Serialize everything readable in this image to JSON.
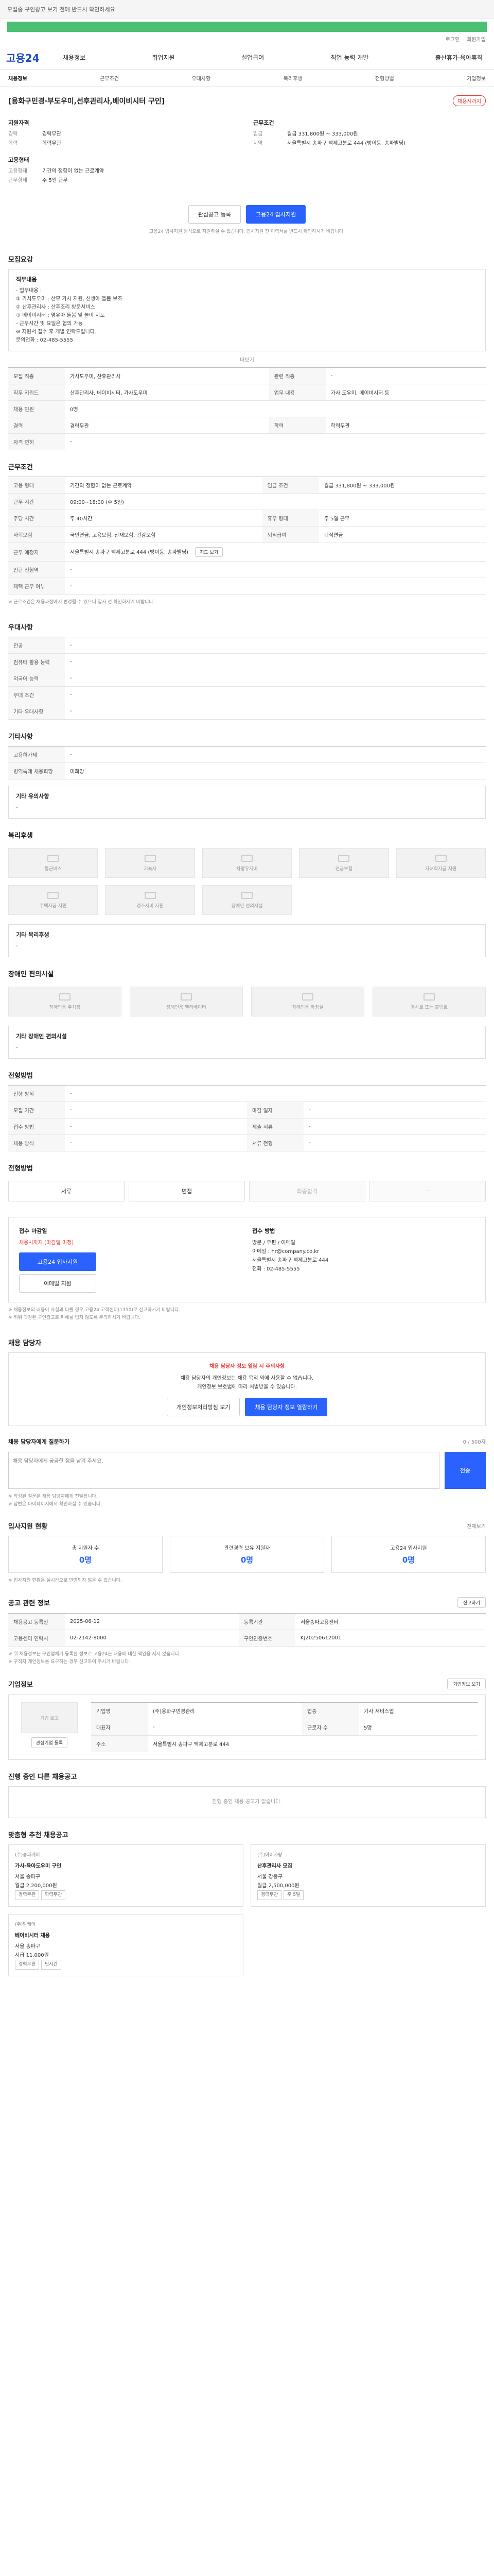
{
  "topbar": {
    "text": "모집중 구인광고 보기 전에 반드시 확인하세요"
  },
  "util": {
    "login": "로그인",
    "join": "회원가입"
  },
  "gnb": {
    "logo": "고용24",
    "menu": [
      "채용정보",
      "취업지원",
      "실업급여",
      "직업 능력 개발",
      "출산휴가·육아휴직"
    ]
  },
  "tabs": [
    "채용정보",
    "근무조건",
    "우대사항",
    "복리후생",
    "전형방법",
    "기업정보"
  ],
  "job": {
    "title": "[용화구민경·부도우미,선후관리사,베이비시터 구인]",
    "status": "채용시까지",
    "left_title": "지원자격",
    "right_title": "근무조건",
    "career_k": "경력",
    "career_v": "경력무관",
    "edu_k": "학력",
    "edu_v": "학력무관",
    "pay_k": "임금",
    "pay_v": "월급 331,800원 ~ 333,000원",
    "place_k": "지역",
    "place_v": "서울특별시 송파구 백제고분로 444 (방이동, 송파빌딩)",
    "type_title": "고용형태",
    "type_k": "고용형태",
    "type_v": "기간의 정함이 없는 근로계약",
    "hours_k": "근무형태",
    "hours_v": "주 5일 근무"
  },
  "actions": {
    "scrap": "관심공고 등록",
    "apply": "고용24 입사지원",
    "notice": "고용24 입사지원 방식으로 지원하실 수 있습니다. 입사지원 전 이력서를 반드시 확인하시기 바랍니다."
  },
  "recruit": {
    "title": "모집요강",
    "desc_title": "직무내용",
    "desc_lines": [
      "- 업무내용 :",
      "① 가사도우미 : 산모 가사 지원, 신생아 돌봄 보조",
      "② 산후관리사 : 산후조리 방문서비스",
      "③ 베이비시터 : 영유아 돌봄 및 놀이 지도",
      "- 근무시간 및 요일은 협의 가능",
      "※ 지원서 접수 후 개별 연락드립니다.",
      "문의전화 : 02-485-5555"
    ],
    "more": "더보기",
    "rows": [
      [
        "모집 직종",
        "가사도우미, 산후관리사",
        "관련 직종",
        "-"
      ],
      [
        "직무 키워드",
        "산후관리사, 베이비시터, 가사도우미",
        "업무 내용",
        "가사 도우미, 베이비시터 등"
      ],
      [
        "채용 인원",
        "0명",
        "",
        ""
      ],
      [
        "경력",
        "경력무관",
        "학력",
        "학력무관"
      ],
      [
        "자격 면허",
        "-",
        "",
        ""
      ]
    ]
  },
  "conditions": {
    "title": "근무조건",
    "rows": [
      [
        "고용 형태",
        "기간의 정함이 없는 근로계약",
        "임금 조건",
        "월급 331,800원 ~ 333,000원"
      ],
      [
        "근무 시간",
        "09:00~18:00 (주 5일)",
        "",
        ""
      ],
      [
        "주당 시간",
        "주 40시간",
        "휴무 형태",
        "주 5일 근무"
      ],
      [
        "사회보험",
        "국민연금, 고용보험, 산재보험, 건강보험",
        "퇴직급여",
        "퇴직연금"
      ],
      [
        "근무 예정지",
        "서울특별시 송파구 백제고분로 444 (방이동, 송파빌딩)",
        "",
        ""
      ],
      [
        "인근 전철역",
        "-",
        "",
        ""
      ],
      [
        "재택 근무 여부",
        "-",
        "",
        ""
      ]
    ],
    "map_label": "지도 보기",
    "note": "※ 근로조건은 채용과정에서 변경될 수 있으니 입사 전 확인하시기 바랍니다."
  },
  "pref": {
    "title": "우대사항",
    "rows": [
      [
        "전공",
        "-"
      ],
      [
        "컴퓨터 활용 능력",
        "-"
      ],
      [
        "외국어 능력",
        "-"
      ],
      [
        "우대 조건",
        "-"
      ],
      [
        "기타 우대사항",
        "-"
      ]
    ]
  },
  "etc": {
    "title": "기타사항",
    "rows": [
      [
        "고용허가제",
        "-"
      ],
      [
        "병역특례 채용희망",
        "미희망"
      ]
    ],
    "detail_title": "기타 유의사항",
    "detail_value": "-"
  },
  "welfare": {
    "title": "복리후생",
    "items": [
      "통근버스",
      "기숙사",
      "차량유지비",
      "연금보험",
      "자녀학자금 지원",
      "주택자금 지원",
      "경조사비 지원",
      "장애인 편의시설"
    ],
    "detail_title": "기타 복리후생",
    "detail_value": "-"
  },
  "facility": {
    "title": "장애인 편의시설",
    "items": [
      "장애인용 주차장",
      "장애인용 엘리베이터",
      "장애인용 화장실",
      "경사로 또는 출입로"
    ],
    "detail_title": "기타 장애인 편의시설",
    "detail_value": "-"
  },
  "process": {
    "title": "전형방법",
    "rows": [
      [
        "전형 방식",
        "-",
        "",
        ""
      ],
      [
        "모집 기간",
        "-",
        "마감 일자",
        "-"
      ],
      [
        "접수 방법",
        "-",
        "제출 서류",
        "-"
      ],
      [
        "채용 방식",
        "-",
        "서류 전형",
        "-"
      ]
    ],
    "steps_title": "전형방법",
    "steps": [
      "서류",
      "면접",
      "최종합격",
      "-"
    ]
  },
  "apply": {
    "left_title": "접수 마감일",
    "left_value": "채용시까지 (마감일 미정)",
    "btn_apply": "고용24 입사지원",
    "btn_email": "이메일 지원",
    "right_title": "접수 방법",
    "right_lines": [
      "방문 / 우편 / 이메일",
      "이메일 : hr@company.co.kr",
      "서울특별시 송파구 백제고분로 444",
      "전화 : 02-485-5555"
    ],
    "notes": [
      "※ 채용정보의 내용이 사실과 다를 경우 고용24 고객센터(1350)로 신고하시기 바랍니다.",
      "※ 허위·과장된 구인광고로 피해를 입지 않도록 주의하시기 바랍니다."
    ]
  },
  "manager": {
    "title": "채용 담당자",
    "highlight": "채용 담당자 정보 열람 시 주의사항",
    "desc1": "채용 담당자의 개인정보는 채용 목적 외에 사용할 수 없습니다.",
    "desc2": "개인정보 보호법에 따라 처벌받을 수 있습니다.",
    "btn_policy": "개인정보처리방침 보기",
    "btn_view": "채용 담당자 정보 열람하기"
  },
  "inquiry": {
    "label": "채용 담당자에게 질문하기",
    "limit": "0 / 500자",
    "placeholder": "채용 담당자에게 궁금한 점을 남겨 주세요.",
    "send": "전송",
    "notes": [
      "※ 작성된 질문은 채용 담당자에게 전달됩니다.",
      "※ 답변은 마이페이지에서 확인하실 수 있습니다."
    ]
  },
  "stats": {
    "title": "입사지원 현황",
    "more": "전체보기",
    "items": [
      {
        "label": "총 지원자 수",
        "value": "0명"
      },
      {
        "label": "관련경력 보유 지원자",
        "value": "0명"
      },
      {
        "label": "고용24 입사지원",
        "value": "0명"
      }
    ],
    "note": "※ 입사지원 현황은 실시간으로 반영되지 않을 수 있습니다."
  },
  "info": {
    "title": "공고 관련 정보",
    "btn": "신고하기",
    "rows": [
      [
        "채용공고 등록일",
        "2025-06-12",
        "등록기관",
        "서울송파고용센터"
      ],
      [
        "고용센터 연락처",
        "02-2142-8000",
        "구인인증번호",
        "KJ20250612001"
      ]
    ],
    "notes": [
      "※ 위 채용정보는 구인업체가 등록한 정보로 고용24는 내용에 대한 책임을 지지 않습니다.",
      "※ 구직자 개인정보를 요구하는 경우 신고하여 주시기 바랍니다."
    ]
  },
  "company": {
    "title": "기업정보",
    "btn": "기업정보 보기",
    "logo_label": "기업 로고",
    "like": "관심기업 등록",
    "rows": [
      [
        "기업명",
        "(주)용화구민경관리",
        "업종",
        "가사 서비스업"
      ],
      [
        "대표자",
        "-",
        "근로자 수",
        "5명"
      ],
      [
        "주소",
        "서울특별시 송파구 백제고분로 444",
        "",
        ""
      ]
    ]
  },
  "related": {
    "title": "진행 중인 다른 채용공고",
    "empty": "진행 중인 채용 공고가 없습니다."
  },
  "recommend": {
    "title": "맞춤형 추천 채용공고",
    "cards": [
      {
        "org": "(주)송파케어",
        "title": "가사·육아도우미 구인",
        "loc": "서울 송파구",
        "pay": "월급 2,200,000원",
        "tags": [
          "경력무관",
          "학력무관"
        ]
      },
      {
        "org": "(주)아이사랑",
        "title": "산후관리사 모집",
        "loc": "서울 강동구",
        "pay": "월급 2,500,000원",
        "tags": [
          "경력무관",
          "주 5일"
        ]
      },
      {
        "org": "(주)맘케어",
        "title": "베이비시터 채용",
        "loc": "서울 송파구",
        "pay": "시급 11,000원",
        "tags": [
          "경력무관",
          "단시간"
        ]
      }
    ]
  }
}
